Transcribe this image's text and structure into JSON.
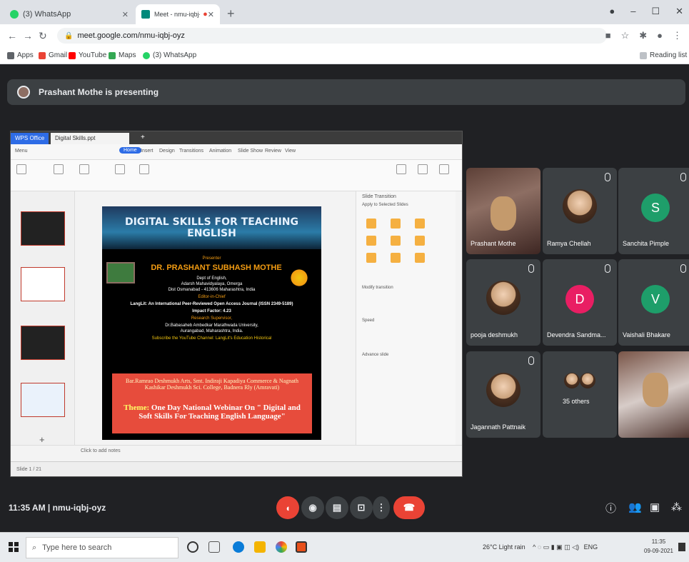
{
  "browser": {
    "tabs": [
      {
        "label": "(3) WhatsApp",
        "color": "#25d366"
      },
      {
        "label": "Meet - nmu-iqbj-oyz",
        "color": "#00897b"
      }
    ],
    "url": "meet.google.com/nmu-iqbj-oyz",
    "bookmarks": [
      "Apps",
      "Gmail",
      "YouTube",
      "Maps",
      "(3) WhatsApp"
    ],
    "reading_list": "Reading list"
  },
  "meet": {
    "presenting_text": "Prashant Mothe is presenting",
    "meeting_info": "11:35 AM | nmu-iqbj-oyz",
    "participants": [
      {
        "name": "Prashant Mothe",
        "kind": "video"
      },
      {
        "name": "Ramya Chellah",
        "kind": "photo"
      },
      {
        "name": "Sanchita Pimple",
        "kind": "letter",
        "letter": "S",
        "color": "#1e9e6a"
      },
      {
        "name": "pooja deshmukh",
        "kind": "photo"
      },
      {
        "name": "Devendra Sandma...",
        "kind": "letter",
        "letter": "D",
        "color": "#e91e63"
      },
      {
        "name": "Vaishali Bhakare",
        "kind": "letter",
        "letter": "V",
        "color": "#1e9e6a"
      },
      {
        "name": "Jagannath Pattnaik",
        "kind": "photo"
      },
      {
        "name": "35 others",
        "kind": "group"
      },
      {
        "name": "",
        "kind": "video2"
      }
    ]
  },
  "slide": {
    "title": "DIGITAL SKILLS FOR TEACHING ENGLISH",
    "presenter_label": "Presenter",
    "presenter": "DR. PRASHANT SUBHASH MOTHE",
    "lines": [
      "Dept of English,",
      "Adarsh Mahavidyalaya, Omerga",
      "Dist Osmanabad - 413606 Maharashtra, India",
      "Editor-in-Chief",
      "LangLit: An International Peer-Reviewed Open Access Journal (ISSN 2349-5189)",
      "Impact Factor: 4.23",
      "Research Supervisor,",
      "Dr.Babasaheb Ambedkar Marathwada University,",
      "Aurangabad, Maharashtra, India.",
      "Subscribe the YouTube Channel: LangLit's Education Historical"
    ],
    "college": "Bar.Ramrao Deshmukh Arts, Smt. Indiraji Kapadiya Commerce & Nagnath Kashikar Deshmukh Sci. College, Badnera Rly (Amravati)",
    "theme_label": "Theme:",
    "theme": "One Day National Webinar On \" Digital and Soft Skills For Teaching English Language\""
  },
  "wps": {
    "tab_app": "WPS Office",
    "tab_file": "Digital Skills.ppt",
    "menu": [
      "Menu",
      "Home",
      "Insert",
      "Design",
      "Transitions",
      "Animation",
      "Slide Show",
      "Review",
      "View"
    ],
    "notes_label": "Click to add notes",
    "status_left": "Slide 1 / 21",
    "transition_title": "Slide Transition",
    "apply_label": "Apply to Selected Slides",
    "modify_label": "Modify transition",
    "speed_label": "Speed",
    "advance_label": "Advance slide"
  },
  "taskbar": {
    "search_placeholder": "Type here to search",
    "weather": "26°C Light rain",
    "lang": "ENG",
    "time": "11:35",
    "date": "09-09-2021"
  }
}
